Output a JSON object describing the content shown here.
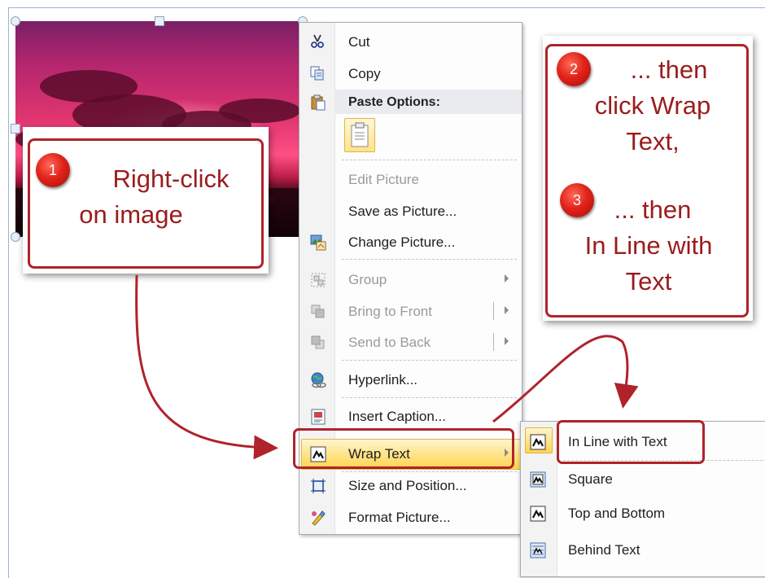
{
  "menu": {
    "items": [
      {
        "id": "cut",
        "label": "Cut",
        "icon": "scissors-icon",
        "disabled": false
      },
      {
        "id": "copy",
        "label": "Copy",
        "icon": "copy-icon",
        "disabled": false
      },
      {
        "id": "edit-picture",
        "label": "Edit Picture",
        "disabled": true
      },
      {
        "id": "save-as-picture",
        "label": "Save as Picture...",
        "disabled": false
      },
      {
        "id": "change-picture",
        "label": "Change Picture...",
        "icon": "change-picture-icon",
        "disabled": false
      },
      {
        "id": "group",
        "label": "Group",
        "icon": "group-icon",
        "disabled": true
      },
      {
        "id": "bring-to-front",
        "label": "Bring to Front",
        "icon": "bring-to-front-icon",
        "disabled": true
      },
      {
        "id": "send-to-back",
        "label": "Send to Back",
        "icon": "send-to-back-icon",
        "disabled": true
      },
      {
        "id": "hyperlink",
        "label": "Hyperlink...",
        "icon": "hyperlink-icon",
        "disabled": false
      },
      {
        "id": "insert-caption",
        "label": "Insert Caption...",
        "icon": "caption-icon",
        "disabled": false
      },
      {
        "id": "wrap-text",
        "label": "Wrap Text",
        "icon": "wrap-text-icon",
        "disabled": false,
        "highlighted": true
      },
      {
        "id": "size-and-position",
        "label": "Size and Position...",
        "icon": "size-position-icon",
        "disabled": false
      },
      {
        "id": "format-picture",
        "label": "Format Picture...",
        "icon": "format-picture-icon",
        "disabled": false
      }
    ],
    "paste_options_label": "Paste Options:"
  },
  "submenu": {
    "items": [
      {
        "id": "in-line-with-text",
        "label": "In Line with Text",
        "highlighted": true
      },
      {
        "id": "square",
        "label": "Square"
      },
      {
        "id": "top-and-bottom",
        "label": "Top and Bottom"
      },
      {
        "id": "behind-text",
        "label": "Behind Text"
      }
    ]
  },
  "callouts": {
    "step1": {
      "number": "1",
      "line1": "Right-click",
      "line2": "on image"
    },
    "step2": {
      "number": "2",
      "line1": "... then",
      "line2": "click Wrap",
      "line3": "Text,"
    },
    "step3": {
      "number": "3",
      "line1": "... then",
      "line2": "In Line with",
      "line3": "Text"
    }
  },
  "colors": {
    "annotation_red": "#b0232a",
    "menu_highlight": "#ffe48a"
  }
}
